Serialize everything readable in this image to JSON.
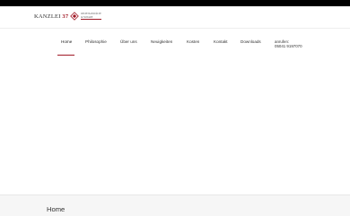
{
  "brand": {
    "wordmark_text": "KANZLEI",
    "wordmark_number": "37",
    "subline_1": "RECHTSANWÄLTE",
    "subline_2": "& NOTARE",
    "accent_color": "#a01825"
  },
  "nav": {
    "items": [
      {
        "label": "Home",
        "active": true
      },
      {
        "label": "Philosophie",
        "active": false
      },
      {
        "label": "Über uns",
        "active": false
      },
      {
        "label": "Neuigkeiten",
        "active": false
      },
      {
        "label": "Kosten",
        "active": false
      },
      {
        "label": "Kontakt",
        "active": false
      },
      {
        "label": "Downloads",
        "active": false
      }
    ],
    "phone_label": "anrufen:",
    "phone_number": "05041 9197070"
  },
  "breadcrumb": {
    "title": "Home"
  }
}
